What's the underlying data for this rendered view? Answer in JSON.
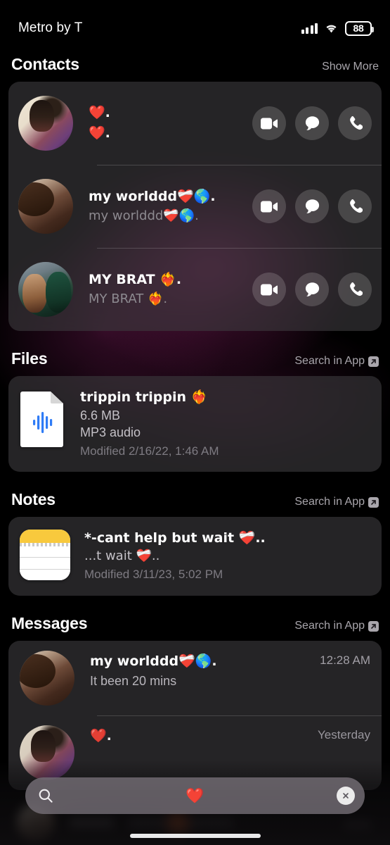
{
  "status_bar": {
    "carrier": "Metro by T",
    "carrier_faded_tail": "",
    "battery_level": "88",
    "signal_icon": "cellular-bars-icon",
    "wifi_icon": "wifi-icon",
    "battery_icon": "battery-icon"
  },
  "sections": {
    "contacts": {
      "title": "Contacts",
      "action_label": "Show More",
      "rows": [
        {
          "name": "❤️.",
          "name_line2": "❤️.",
          "subtitle": "",
          "avatar": "contact-avatar-1"
        },
        {
          "name": "my worlddd❤️‍🩹🌎.",
          "name_line2": "",
          "subtitle": "my worlddd❤️‍🩹🌎.",
          "avatar": "contact-avatar-2"
        },
        {
          "name": "MY BRAT ❤️‍🔥.",
          "name_line2": "",
          "subtitle": "MY BRAT ❤️‍🔥.",
          "avatar": "contact-avatar-3"
        }
      ],
      "actions": {
        "video_label": "video-call",
        "message_label": "message",
        "phone_label": "phone-call"
      }
    },
    "files": {
      "title": "Files",
      "action_label": "Search in App",
      "item": {
        "title": "trippin trippin ❤️‍🔥",
        "size": "6.6 MB",
        "kind": "MP3 audio",
        "modified": "Modified 2/16/22, 1:46 AM",
        "icon": "audio-file-icon"
      }
    },
    "notes": {
      "title": "Notes",
      "action_label": "Search in App",
      "item": {
        "title": "*-cant help but wait ❤️‍🩹..",
        "snippet": "...t wait ❤️‍🩹..",
        "modified": "Modified 3/11/23, 5:02 PM",
        "icon": "notes-app-icon"
      }
    },
    "messages": {
      "title": "Messages",
      "action_label": "Search in App",
      "rows": [
        {
          "name": "my worlddd❤️‍🩹🌎.",
          "preview": "It been 20 mins",
          "time": "12:28 AM",
          "avatar": "message-avatar-1"
        },
        {
          "name": "❤️.",
          "preview": "",
          "time": "Yesterday",
          "avatar": "message-avatar-2"
        }
      ]
    }
  },
  "search": {
    "value": "❤️",
    "placeholder": "Search",
    "search_icon": "search-icon",
    "clear_icon": "clear-icon"
  },
  "colors": {
    "accent_magenta": "#962370",
    "card_bg": "#3c3a3e",
    "notes_yellow": "#f8c93d",
    "audio_blue": "#2f7cf6",
    "secondary_text": "#8d8a90"
  }
}
